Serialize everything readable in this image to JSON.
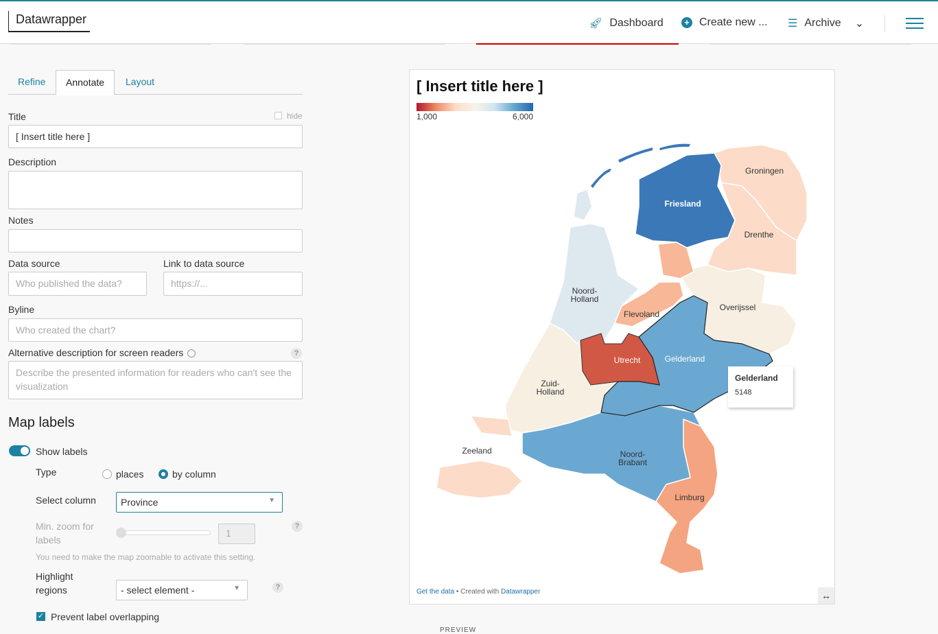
{
  "header": {
    "logo": "Datawrapper",
    "dashboard": "Dashboard",
    "create_new": "Create new ...",
    "archive": "Archive"
  },
  "tabs": [
    "Refine",
    "Annotate",
    "Layout"
  ],
  "form": {
    "title_label": "Title",
    "hide_label": "hide",
    "title_value": "[ Insert title here ]",
    "description_label": "Description",
    "notes_label": "Notes",
    "source_label": "Data source",
    "source_placeholder": "Who published the data?",
    "link_label": "Link to data source",
    "link_placeholder": "https://...",
    "byline_label": "Byline",
    "byline_placeholder": "Who created the chart?",
    "alt_label": "Alternative description for screen readers",
    "alt_placeholder": "Describe the presented information for readers who can't see the visualization"
  },
  "map_labels": {
    "heading": "Map labels",
    "show_labels": "Show labels",
    "type_label": "Type",
    "type_places": "places",
    "type_by_column": "by column",
    "select_column_label": "Select column",
    "select_column_value": "Province",
    "min_zoom_label": "Min. zoom for labels",
    "min_zoom_value": "1",
    "zoom_note": "You need to make the map zoomable to activate this setting.",
    "highlight_label": "Highlight regions",
    "highlight_value": "- select element -",
    "prevent_overlap": "Prevent label overlapping"
  },
  "chart": {
    "title": "[ Insert title here ]",
    "legend_min": "1,000",
    "legend_max": "6,000",
    "footer_get_data": "Get the data",
    "footer_sep": " • Created with ",
    "footer_dw": "Datawrapper",
    "tooltip_name": "Gelderland",
    "tooltip_value": "5148",
    "provinces": {
      "groningen": "Groningen",
      "friesland": "Friesland",
      "drenthe": "Drenthe",
      "noord_holland_1": "Noord-",
      "noord_holland_2": "Holland",
      "flevoland": "Flevoland",
      "overijssel": "Overijssel",
      "utrecht": "Utrecht",
      "gelderland": "Gelderland",
      "zuid_holland_1": "Zuid-",
      "zuid_holland_2": "Holland",
      "zeeland": "Zeeland",
      "noord_brabant_1": "Noord-",
      "noord_brabant_2": "Brabant",
      "limburg": "Limburg"
    }
  },
  "colors": {
    "accent": "#1d81a2",
    "friesland": "#3a78b8",
    "gelderland": "#6aa8d2",
    "noord_holland": "#dde9ef",
    "neutral": "#f8efe3",
    "light_orange": "#fcdcc8",
    "flevoland": "#f8b898",
    "limburg": "#f5a481",
    "utrecht": "#d05845"
  },
  "preview_label": "PREVIEW"
}
